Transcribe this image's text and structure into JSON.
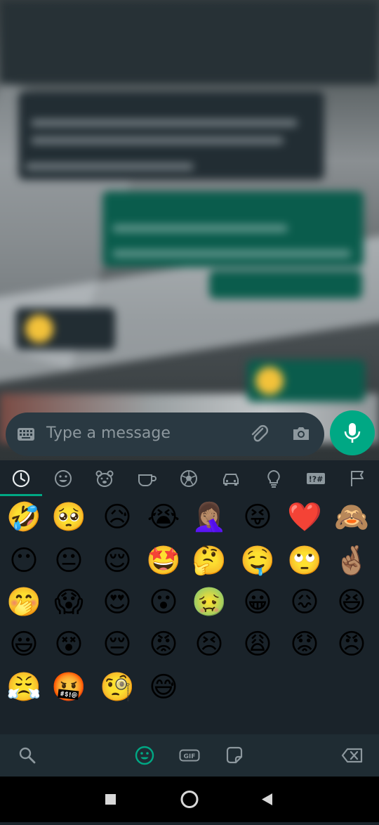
{
  "composer": {
    "placeholder": "Type a message"
  },
  "emoji_tabs": [
    {
      "name": "recent-tab",
      "icon": "clock-icon",
      "active": true
    },
    {
      "name": "smileys-tab",
      "icon": "smiley-icon"
    },
    {
      "name": "animals-tab",
      "icon": "bear-icon"
    },
    {
      "name": "food-tab",
      "icon": "cup-icon"
    },
    {
      "name": "activity-tab",
      "icon": "soccer-ball-icon"
    },
    {
      "name": "travel-tab",
      "icon": "car-icon"
    },
    {
      "name": "objects-tab",
      "icon": "lightbulb-icon"
    },
    {
      "name": "symbols-tab",
      "icon": "symbols-icon",
      "label": "!?#"
    },
    {
      "name": "flags-tab",
      "icon": "flag-icon"
    }
  ],
  "emojis": [
    "🤣",
    "🥺",
    "😥",
    "😭",
    "🤦🏽‍♀️",
    "😝",
    "❤️",
    "🙈",
    "😶",
    "😐",
    "😌",
    "🤩",
    "🤔",
    "🤤",
    "🙄",
    "🤞🏽",
    "🤭",
    "😱",
    "😍",
    "😮",
    "🤢",
    "😀",
    "😖",
    "😆",
    "😃",
    "😵",
    "😔",
    "😡",
    "😣",
    "😩",
    "😟",
    "😠",
    "😤",
    "🤬",
    "🧐",
    "😅"
  ],
  "toolbar": {
    "gif_label": "GIF",
    "icons": [
      "search-icon",
      "emoji-icon",
      "gif-icon",
      "sticker-icon",
      "backspace-icon"
    ]
  },
  "colors": {
    "accent": "#00a884",
    "panel_bg": "#1a232a",
    "composer_bg": "#2a3942"
  }
}
